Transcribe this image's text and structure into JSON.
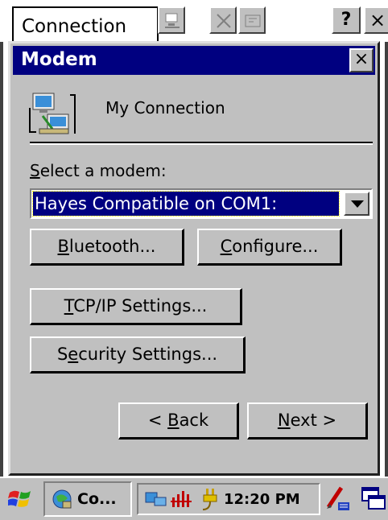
{
  "background_window": {
    "title": "Connection",
    "help_label": "?",
    "close_label": "×"
  },
  "dialog": {
    "title": "Modem",
    "close_label": "×",
    "connection_name": "My Connection",
    "select_label_accel": "S",
    "select_label_rest": "elect a modem:",
    "modem_selected": "Hayes Compatible on COM1:",
    "buttons": {
      "bluetooth_accel": "B",
      "bluetooth_rest": "luetooth...",
      "configure_accel": "C",
      "configure_rest": "onfigure...",
      "tcpip_accel": "T",
      "tcpip_rest": "CP/IP Settings...",
      "security_pre": "S",
      "security_accel": "e",
      "security_rest": "curity Settings...",
      "back_pre": "< ",
      "back_accel": "B",
      "back_rest": "ack",
      "next_accel": "N",
      "next_rest": "ext >"
    }
  },
  "taskbar": {
    "task_label": "Co...",
    "time": "12:20 PM"
  },
  "colors": {
    "title_bar": "#000080",
    "face": "#c0c0c0",
    "selection": "#000080"
  },
  "icons": {
    "start": "windows-flag-icon",
    "connection": "network-connection-icon",
    "dropdown": "chevron-down-icon",
    "tray_network": "network-status-icon",
    "tray_signal": "signal-bars-icon",
    "tray_power": "power-plug-icon",
    "input_panel": "input-panel-icon",
    "desktop": "show-desktop-icon"
  }
}
